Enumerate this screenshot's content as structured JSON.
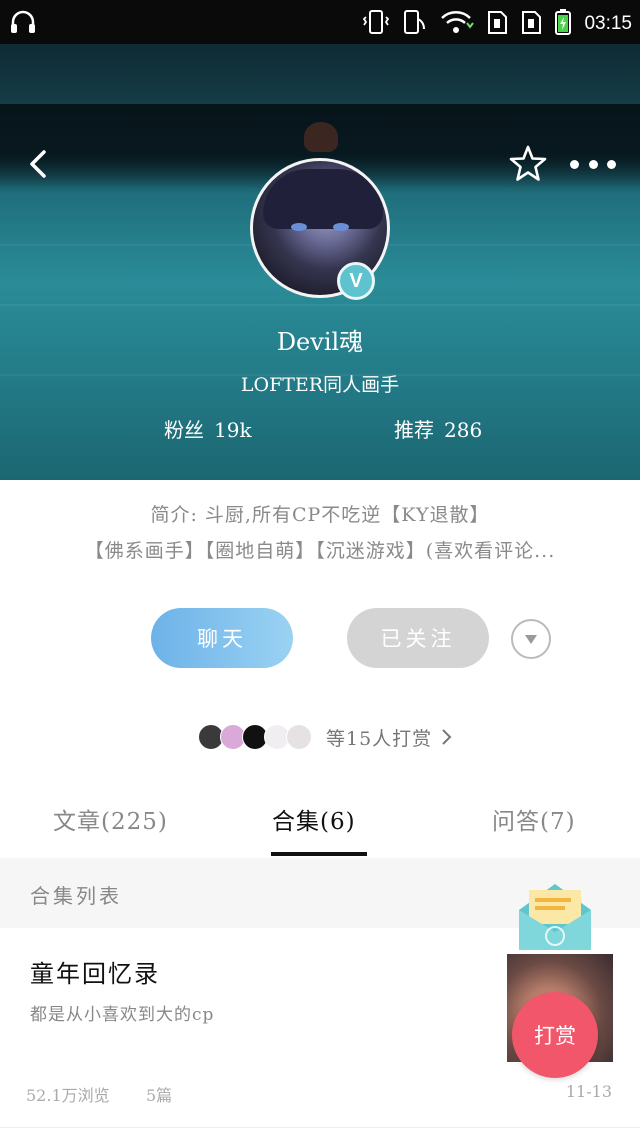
{
  "status_bar": {
    "time": "03:15"
  },
  "profile": {
    "username": "Devil魂",
    "title": "LOFTER同人画手",
    "fans_label": "粉丝",
    "fans_value": "19k",
    "recommend_label": "推荐",
    "recommend_value": "286",
    "verified_mark": "V"
  },
  "bio": {
    "line1": "简介: 斗厨,所有CP不吃逆【KY退散】",
    "line2": "【佛系画手】【圈地自萌】【沉迷游戏】(喜欢看评论..."
  },
  "actions": {
    "chat": "聊天",
    "follow": "已关注"
  },
  "tips": {
    "text": "等15人打赏"
  },
  "tabs": [
    {
      "label": "文章(225)"
    },
    {
      "label": "合集(6)"
    },
    {
      "label": "问答(7)"
    }
  ],
  "section": {
    "title": "合集列表"
  },
  "collection": {
    "title": "童年回忆录",
    "desc": "都是从小喜欢到大的cp",
    "views": "52.1万浏览",
    "count": "5篇",
    "date": "11-13"
  },
  "float": {
    "tip_button": "打赏"
  },
  "colors": {
    "chat_button": "#6db2e8",
    "follow_button": "#d4d4d4",
    "tip_button": "#f1566a",
    "verified": "#5ec2cf"
  }
}
